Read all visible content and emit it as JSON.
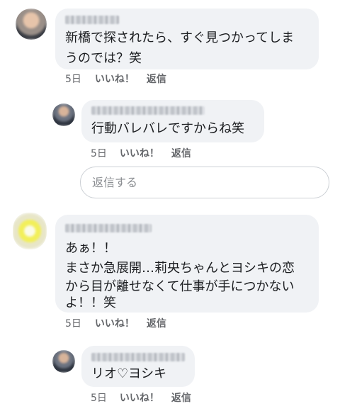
{
  "comments": [
    {
      "text_line1": "新橋で探されたら、すぐ見つかってしま",
      "text_line2": "うのでは？笑",
      "time": "5日",
      "like_label": "いいね！",
      "reply_label": "返信"
    },
    {
      "text_line1": "行動バレバレですからね笑",
      "time": "5日",
      "like_label": "いいね！",
      "reply_label": "返信"
    },
    {
      "text_line1": "あぁ！！",
      "text_line2": "まさか急展開…莉央ちゃんとヨシキの恋",
      "text_line3": "から目が離せなくて仕事が手につかない",
      "text_line4": "よ！！笑",
      "time": "5日",
      "like_label": "いいね！",
      "reply_label": "返信"
    },
    {
      "text_line1": "リオ♡ヨシキ",
      "time": "5日",
      "like_label": "いいね！",
      "reply_label": "返信"
    }
  ],
  "reply_box": {
    "placeholder": "返信する"
  },
  "colors": {
    "bubble": "#f0f2f5",
    "action_text": "#65676b",
    "body_text": "#1c1e21",
    "input_border": "#ccd0d5"
  }
}
